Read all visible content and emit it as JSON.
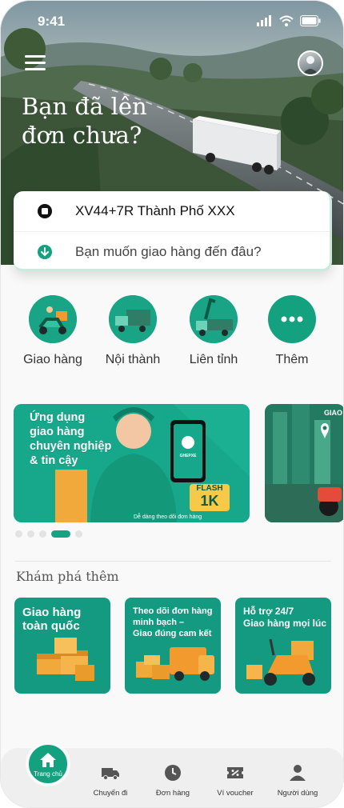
{
  "status_bar": {
    "time": "9:41"
  },
  "hero": {
    "title_line1": "Bạn đã lên",
    "title_line2": "đơn chưa?"
  },
  "address": {
    "pickup": "XV44+7R Thành Phố XXX",
    "destination_placeholder": "Bạn muốn giao hàng đến đâu?"
  },
  "services": [
    {
      "label": "Giao hàng",
      "icon": "scooter-icon"
    },
    {
      "label": "Nội thành",
      "icon": "truck-icon"
    },
    {
      "label": "Liên tỉnh",
      "icon": "crane-truck-icon"
    },
    {
      "label": "Thêm",
      "icon": "more-icon"
    }
  ],
  "banners": {
    "first": {
      "headline_1": "Ứng dụng",
      "headline_2": "giao hàng",
      "headline_3": "chuyên nghiệp",
      "headline_4": "& tin cậy",
      "phone_brand": "GHEPXE",
      "flash_label": "FLASH",
      "flash_value": "1K",
      "footer": "Dễ dàng theo dõi đơn hàng"
    },
    "second": {
      "corner_text": "GIAO"
    },
    "pager": {
      "count": 5,
      "active_index": 3
    }
  },
  "explore": {
    "title": "Khám phá thêm",
    "cards": [
      {
        "line1": "Giao hàng",
        "line2": "toàn quốc"
      },
      {
        "line1": "Theo dõi đơn hàng",
        "line2": "minh bạch –",
        "line3": "Giao đúng cam kết"
      },
      {
        "line1": "Hỗ trợ 24/7",
        "line2": "Giao hàng mọi lúc"
      }
    ]
  },
  "bottom_nav": {
    "home": "Trang chủ",
    "items": [
      "Chuyến đi",
      "Đơn hàng",
      "Ví voucher",
      "Người dùng"
    ]
  },
  "colors": {
    "brand": "#13a17f",
    "brand_dark": "#0f7f66",
    "accent_orange": "#f29a2e"
  }
}
